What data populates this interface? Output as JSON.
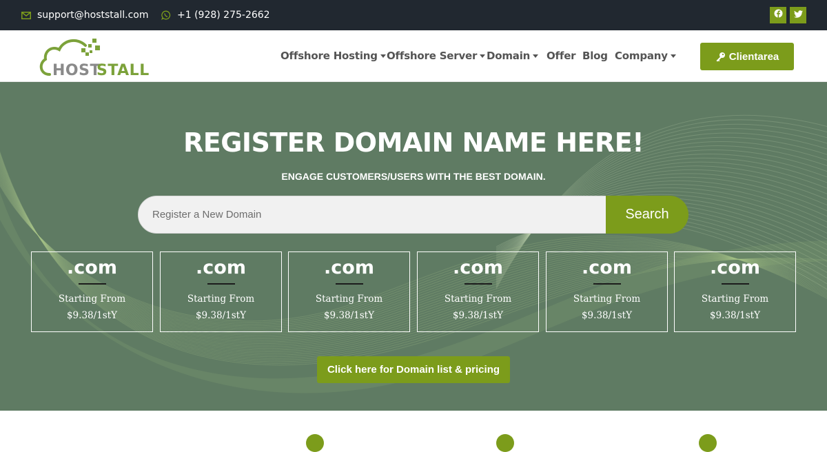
{
  "topbar": {
    "email": "support@hoststall.com",
    "phone": "+1 (928) 275-2662",
    "email_icon": "envelope-icon",
    "phone_icon": "whatsapp-icon",
    "social": [
      {
        "name": "facebook",
        "icon": "facebook-icon"
      },
      {
        "name": "twitter",
        "icon": "twitter-icon"
      }
    ]
  },
  "header": {
    "logo_text_1": "HOST",
    "logo_text_2": "STALL",
    "nav": [
      {
        "label": "Offshore Hosting",
        "dropdown": true
      },
      {
        "label": "Offshore Server",
        "dropdown": true
      },
      {
        "label": "Domain",
        "dropdown": true
      },
      {
        "label": "Offer",
        "dropdown": false
      },
      {
        "label": "Blog",
        "dropdown": false
      },
      {
        "label": "Company",
        "dropdown": true
      }
    ],
    "client_button": {
      "label": "Clientarea",
      "icon": "key-icon"
    }
  },
  "hero": {
    "title": "REGISTER DOMAIN NAME HERE!",
    "subtitle": "ENGAGE CUSTOMERS/USERS WITH THE BEST DOMAIN.",
    "search": {
      "placeholder": "Register a New Domain",
      "value": "",
      "button_label": "Search"
    },
    "tlds": [
      {
        "tld": ".com",
        "from_label": "Starting From",
        "price": "$9.38/1stY"
      },
      {
        "tld": ".com",
        "from_label": "Starting From",
        "price": "$9.38/1stY"
      },
      {
        "tld": ".com",
        "from_label": "Starting From",
        "price": "$9.38/1stY"
      },
      {
        "tld": ".com",
        "from_label": "Starting From",
        "price": "$9.38/1stY"
      },
      {
        "tld": ".com",
        "from_label": "Starting From",
        "price": "$9.38/1stY"
      },
      {
        "tld": ".com",
        "from_label": "Starting From",
        "price": "$9.38/1stY"
      }
    ],
    "pricing_button": "Click here for Domain list & pricing"
  },
  "colors": {
    "brand_green": "#7c9c1b",
    "hero_bg": "#5f7b63",
    "topbar_bg": "#212830",
    "nav_text": "#545454"
  }
}
